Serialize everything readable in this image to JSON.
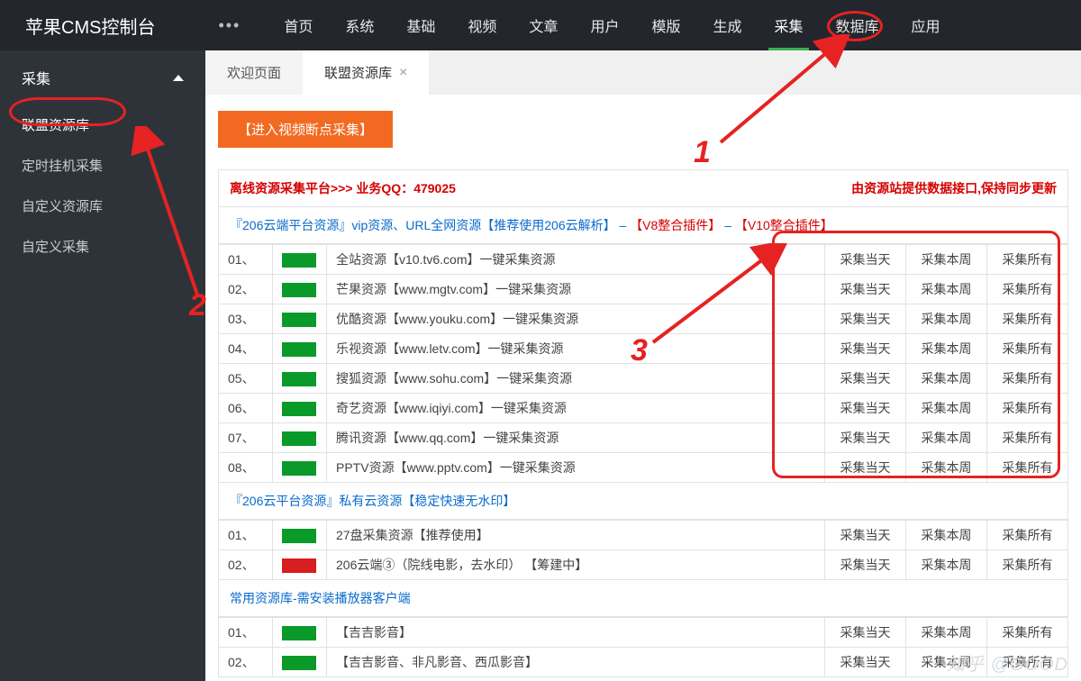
{
  "topbar": {
    "title": "苹果CMS控制台",
    "nav": [
      "首页",
      "系统",
      "基础",
      "视频",
      "文章",
      "用户",
      "模版",
      "生成",
      "采集",
      "数据库",
      "应用"
    ],
    "active_index": 8
  },
  "sidebar": {
    "group_title": "采集",
    "items": [
      "联盟资源库",
      "定时挂机采集",
      "自定义资源库",
      "自定义采集"
    ],
    "active_index": 0
  },
  "tabs": {
    "items": [
      {
        "label": "欢迎页面",
        "closable": false
      },
      {
        "label": "联盟资源库",
        "closable": true
      }
    ],
    "active_index": 1
  },
  "panel": {
    "enter_btn": "【进入视频断点采集】",
    "notice_left": "离线资源采集平台>>> 业务QQ：479025",
    "notice_right": "由资源站提供数据接口,保持同步更新",
    "section1": {
      "title_prefix": "『206云端平台资源』vip资源、URL全网资源【推荐使用206云解析】 – ",
      "v8": "【V8整合插件】",
      "sep": " – ",
      "v10": "【V10整合插件】",
      "rows": [
        {
          "idx": "01、",
          "desc": "全站资源【v10.tv6.com】一键采集资源"
        },
        {
          "idx": "02、",
          "desc": "芒果资源【www.mgtv.com】一键采集资源"
        },
        {
          "idx": "03、",
          "desc": "优酷资源【www.youku.com】一键采集资源"
        },
        {
          "idx": "04、",
          "desc": "乐视资源【www.letv.com】一键采集资源"
        },
        {
          "idx": "05、",
          "desc": "搜狐资源【www.sohu.com】一键采集资源"
        },
        {
          "idx": "06、",
          "desc": "奇艺资源【www.iqiyi.com】一键采集资源"
        },
        {
          "idx": "07、",
          "desc": "腾讯资源【www.qq.com】一键采集资源"
        },
        {
          "idx": "08、",
          "desc": "PPTV资源【www.pptv.com】一键采集资源"
        }
      ]
    },
    "section2": {
      "title": "『206云平台资源』私有云资源【稳定快速无水印】",
      "rows": [
        {
          "idx": "01、",
          "desc": "27盘采集资源【推荐使用】",
          "color": "green"
        },
        {
          "idx": "02、",
          "desc": "206云端③（院线电影，去水印） 【筹建中】",
          "color": "red"
        }
      ]
    },
    "section3": {
      "title": "常用资源库-需安装播放器客户端",
      "rows": [
        {
          "idx": "01、",
          "desc": "【吉吉影音】",
          "color": "green"
        },
        {
          "idx": "02、",
          "desc": "【吉吉影音、非凡影音、西瓜影音】",
          "color": "green"
        }
      ]
    },
    "actions": {
      "today": "采集当天",
      "week": "采集本周",
      "all": "采集所有"
    }
  },
  "annotations": {
    "num1": "1",
    "num2": "2",
    "num3": "3"
  },
  "watermark": "知乎 @GOOD"
}
